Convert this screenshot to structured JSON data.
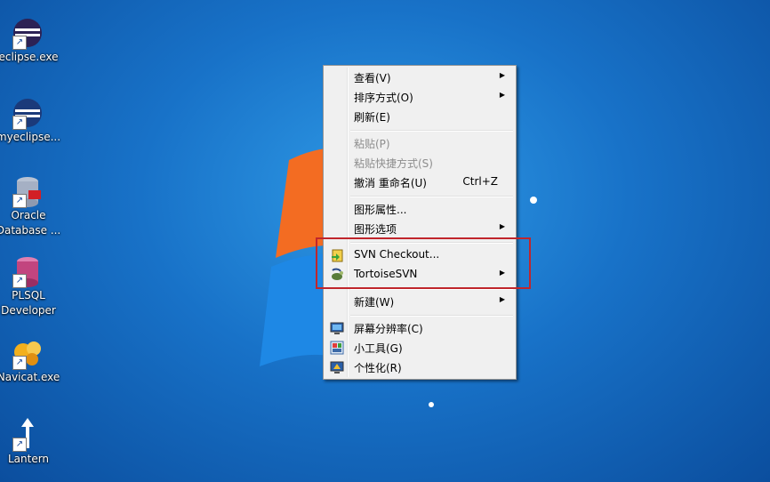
{
  "desktop": {
    "icons": [
      {
        "label": "eclipse.exe",
        "icon": "eclipse-icon"
      },
      {
        "label": "myeclipse...",
        "icon": "myeclipse-icon"
      },
      {
        "label": "Oracle\nDatabase ...",
        "icon": "oracle-database-icon"
      },
      {
        "label": "PLSQL\nDeveloper",
        "icon": "plsql-developer-icon"
      },
      {
        "label": "Navicat.exe",
        "icon": "navicat-icon"
      },
      {
        "label": "Lantern",
        "icon": "lantern-icon"
      }
    ]
  },
  "context_menu": {
    "view": "查看(V)",
    "sort": "排序方式(O)",
    "refresh": "刷新(E)",
    "paste": "粘贴(P)",
    "paste_shortcut": "粘贴快捷方式(S)",
    "undo_rename": "撤消 重命名(U)",
    "undo_shortcut": "Ctrl+Z",
    "graphics_properties": "图形属性...",
    "graphics_options": "图形选项",
    "svn_checkout": "SVN Checkout...",
    "tortoise_svn": "TortoiseSVN",
    "new": "新建(W)",
    "screen_resolution": "屏幕分辨率(C)",
    "gadgets": "小工具(G)",
    "personalize": "个性化(R)"
  },
  "colors": {
    "highlight_box": "#c0262c",
    "desktop_bg": "#1872c8"
  }
}
